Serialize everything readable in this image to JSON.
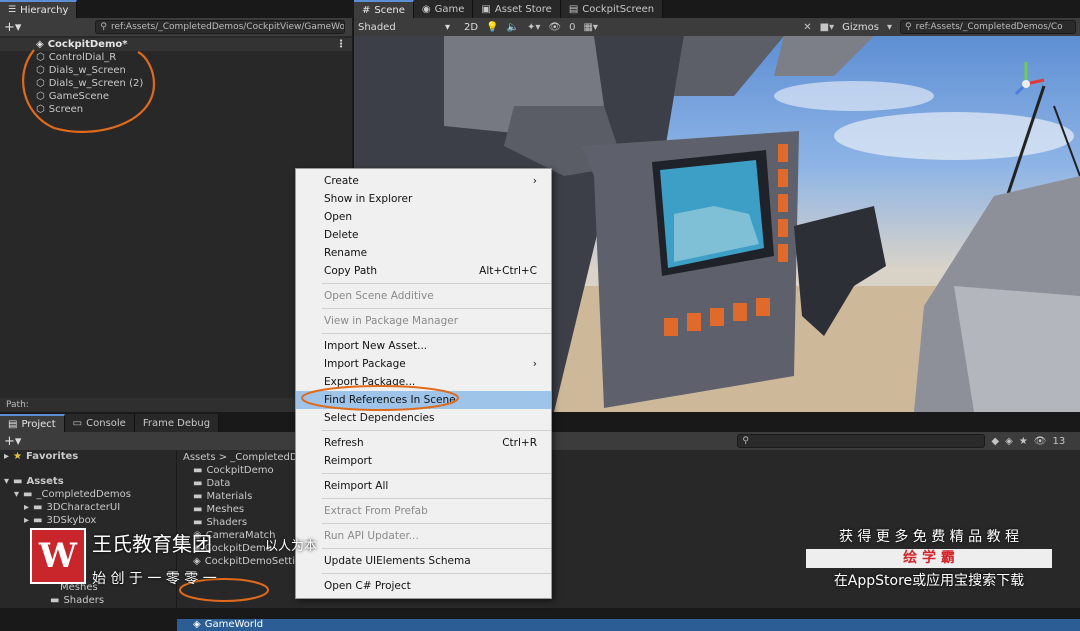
{
  "hierarchy": {
    "tab": "Hierarchy",
    "search": "ref:Assets/_CompletedDemos/CockpitView/GameWo",
    "root": "CockpitDemo*",
    "items": [
      "ControlDial_R",
      "Dials_w_Screen",
      "Dials_w_Screen (2)",
      "GameScene",
      "Screen"
    ],
    "path_label": "Path:"
  },
  "scene": {
    "tabs": [
      "Scene",
      "Game",
      "Asset Store",
      "CockpitScreen"
    ],
    "shading": "Shaded",
    "mode_2d": "2D",
    "hidden_count": "0",
    "gizmos": "Gizmos",
    "search": "ref:Assets/_CompletedDemos/Co"
  },
  "project": {
    "tabs": [
      "Project",
      "Console",
      "Frame Debug"
    ],
    "favorites": "Favorites",
    "assets": "Assets",
    "tree": [
      "_CompletedDemos",
      "3DCharacterUI",
      "3DSkybox"
    ],
    "tree_bottom": [
      "Meshes",
      "Shaders"
    ],
    "breadcrumb": "Assets > _CompletedDe",
    "files": [
      "CockpitDemo",
      "Data",
      "Materials",
      "Meshes",
      "Shaders",
      "CameraMatch",
      "CockpitDemo",
      "CockpitDemoSetti"
    ],
    "selected_file": "GameWorld",
    "count": "13"
  },
  "context_menu": {
    "items": [
      {
        "label": "Create",
        "arrow": "›"
      },
      {
        "label": "Show in Explorer"
      },
      {
        "label": "Open"
      },
      {
        "label": "Delete"
      },
      {
        "label": "Rename"
      },
      {
        "label": "Copy Path",
        "shortcut": "Alt+Ctrl+C"
      },
      {
        "sep": true
      },
      {
        "label": "Open Scene Additive",
        "disabled": true
      },
      {
        "sep": true
      },
      {
        "label": "View in Package Manager",
        "disabled": true
      },
      {
        "sep": true
      },
      {
        "label": "Import New Asset..."
      },
      {
        "label": "Import Package",
        "arrow": "›"
      },
      {
        "label": "Export Package..."
      },
      {
        "label": "Find References In Scene",
        "highlight": true
      },
      {
        "label": "Select Dependencies"
      },
      {
        "sep": true
      },
      {
        "label": "Refresh",
        "shortcut": "Ctrl+R"
      },
      {
        "label": "Reimport"
      },
      {
        "sep": true
      },
      {
        "label": "Reimport All"
      },
      {
        "sep": true
      },
      {
        "label": "Extract From Prefab",
        "disabled": true
      },
      {
        "sep": true
      },
      {
        "label": "Run API Updater...",
        "disabled": true
      },
      {
        "sep": true
      },
      {
        "label": "Update UIElements Schema"
      },
      {
        "sep": true
      },
      {
        "label": "Open C# Project"
      }
    ]
  },
  "watermark": {
    "brand": "王氏教育集团",
    "slogan": "以人为本",
    "founded": "始 创 于 一 零 零 一",
    "promo_line1": "获 得 更 多 免 费 精 品 教 程",
    "promo_app": "绘 学 霸",
    "promo_line3": "在AppStore或应用宝搜索下载"
  },
  "colors": {
    "accent": "#5b8fd1",
    "annotation": "#e06a1b",
    "highlight": "#9fc4ea"
  }
}
